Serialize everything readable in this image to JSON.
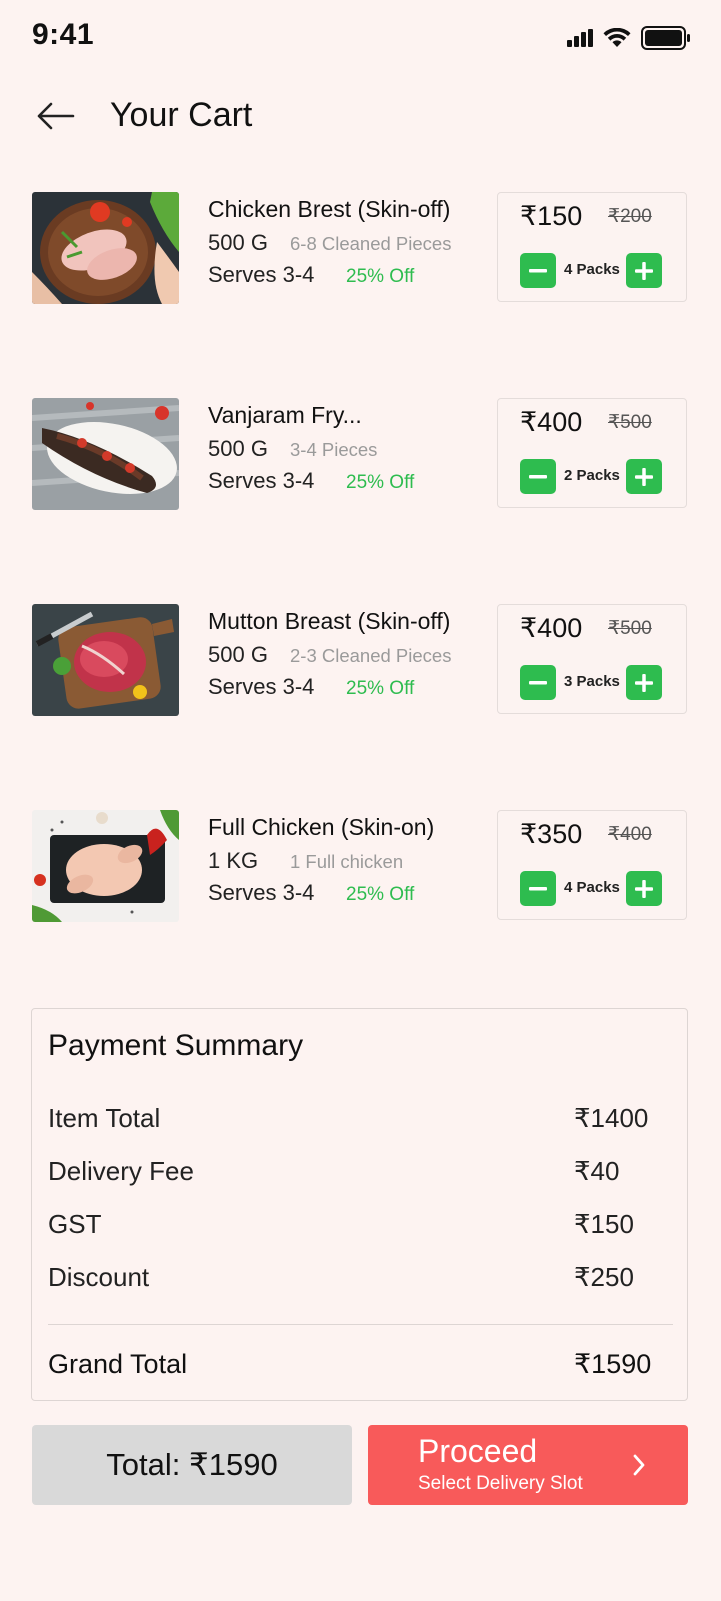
{
  "status": {
    "time": "9:41"
  },
  "header": {
    "title": "Your Cart"
  },
  "items": [
    {
      "name": "Chicken Brest (Skin-off)",
      "weight": "500 G",
      "pieces": "6-8 Cleaned Pieces",
      "serves": "Serves 3-4",
      "discount": "25% Off",
      "price": "₹150",
      "old_price": "₹200",
      "qty": "4 Packs"
    },
    {
      "name": "Vanjaram Fry...",
      "weight": "500 G",
      "pieces": "3-4 Pieces",
      "serves": "Serves 3-4",
      "discount": "25% Off",
      "price": "₹400",
      "old_price": "₹500",
      "qty": "2 Packs"
    },
    {
      "name": "Mutton Breast (Skin-off)",
      "weight": "500 G",
      "pieces": "2-3 Cleaned Pieces",
      "serves": "Serves 3-4",
      "discount": "25% Off",
      "price": "₹400",
      "old_price": "₹500",
      "qty": "3 Packs"
    },
    {
      "name": "Full Chicken (Skin-on)",
      "weight": "1 KG",
      "pieces": "1 Full chicken",
      "serves": "Serves 3-4",
      "discount": "25% Off",
      "price": "₹350",
      "old_price": "₹400",
      "qty": "4 Packs"
    }
  ],
  "summary": {
    "title": "Payment Summary",
    "rows": [
      {
        "label": "Item Total",
        "value": "₹1400"
      },
      {
        "label": "Delivery Fee",
        "value": "₹40"
      },
      {
        "label": "GST",
        "value": "₹150"
      },
      {
        "label": "Discount",
        "value": "₹250"
      }
    ],
    "grand_label": "Grand Total",
    "grand_value": "₹1590"
  },
  "footer": {
    "total": "Total: ₹1590",
    "proceed": "Proceed",
    "proceed_sub": "Select Delivery Slot"
  },
  "colors": {
    "accent_green": "#2ebc4f",
    "proceed_red": "#f85a5a",
    "background": "#fdf3f1"
  }
}
